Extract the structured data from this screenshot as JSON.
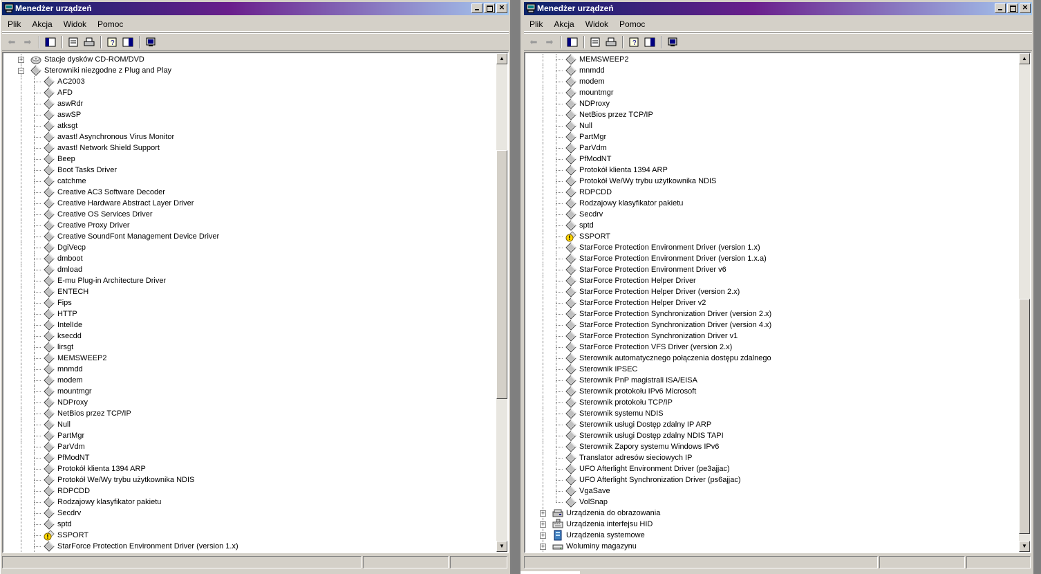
{
  "left_window": {
    "title": "Menedżer urządzeń",
    "menu": [
      "Plik",
      "Akcja",
      "Widok",
      "Pomoc"
    ],
    "tree": [
      {
        "label": "Stacje dysków CD-ROM/DVD",
        "level": 0,
        "expander": "+",
        "icon": "cdrom-icon"
      },
      {
        "label": "Sterowniki niezgodne z Plug and Play",
        "level": 0,
        "expander": "-",
        "icon": "device-icon"
      },
      {
        "label": "AC2003",
        "level": 1,
        "icon": "device-icon"
      },
      {
        "label": "AFD",
        "level": 1,
        "icon": "device-icon"
      },
      {
        "label": "aswRdr",
        "level": 1,
        "icon": "device-icon"
      },
      {
        "label": "aswSP",
        "level": 1,
        "icon": "device-icon"
      },
      {
        "label": "atksgt",
        "level": 1,
        "icon": "device-icon"
      },
      {
        "label": "avast! Asynchronous Virus Monitor",
        "level": 1,
        "icon": "device-icon"
      },
      {
        "label": "avast! Network Shield Support",
        "level": 1,
        "icon": "device-icon"
      },
      {
        "label": "Beep",
        "level": 1,
        "icon": "device-icon"
      },
      {
        "label": "Boot Tasks Driver",
        "level": 1,
        "icon": "device-icon"
      },
      {
        "label": "catchme",
        "level": 1,
        "icon": "device-icon"
      },
      {
        "label": "Creative AC3 Software Decoder",
        "level": 1,
        "icon": "device-icon"
      },
      {
        "label": "Creative Hardware Abstract Layer Driver",
        "level": 1,
        "icon": "device-icon"
      },
      {
        "label": "Creative OS Services Driver",
        "level": 1,
        "icon": "device-icon"
      },
      {
        "label": "Creative Proxy Driver",
        "level": 1,
        "icon": "device-icon"
      },
      {
        "label": "Creative SoundFont Management Device Driver",
        "level": 1,
        "icon": "device-icon"
      },
      {
        "label": "DgiVecp",
        "level": 1,
        "icon": "device-icon"
      },
      {
        "label": "dmboot",
        "level": 1,
        "icon": "device-icon"
      },
      {
        "label": "dmload",
        "level": 1,
        "icon": "device-icon"
      },
      {
        "label": "E-mu Plug-in Architecture Driver",
        "level": 1,
        "icon": "device-icon"
      },
      {
        "label": "ENTECH",
        "level": 1,
        "icon": "device-icon"
      },
      {
        "label": "Fips",
        "level": 1,
        "icon": "device-icon"
      },
      {
        "label": "HTTP",
        "level": 1,
        "icon": "device-icon"
      },
      {
        "label": "IntelIde",
        "level": 1,
        "icon": "device-icon"
      },
      {
        "label": "ksecdd",
        "level": 1,
        "icon": "device-icon"
      },
      {
        "label": "lirsgt",
        "level": 1,
        "icon": "device-icon"
      },
      {
        "label": "MEMSWEEP2",
        "level": 1,
        "icon": "device-icon"
      },
      {
        "label": "mnmdd",
        "level": 1,
        "icon": "device-icon"
      },
      {
        "label": "modem",
        "level": 1,
        "icon": "device-icon"
      },
      {
        "label": "mountmgr",
        "level": 1,
        "icon": "device-icon"
      },
      {
        "label": "NDProxy",
        "level": 1,
        "icon": "device-icon"
      },
      {
        "label": "NetBios przez TCP/IP",
        "level": 1,
        "icon": "device-icon"
      },
      {
        "label": "Null",
        "level": 1,
        "icon": "device-icon"
      },
      {
        "label": "PartMgr",
        "level": 1,
        "icon": "device-icon"
      },
      {
        "label": "ParVdm",
        "level": 1,
        "icon": "device-icon"
      },
      {
        "label": "PfModNT",
        "level": 1,
        "icon": "device-icon"
      },
      {
        "label": "Protokół klienta 1394 ARP",
        "level": 1,
        "icon": "device-icon"
      },
      {
        "label": "Protokół We/Wy trybu użytkownika NDIS",
        "level": 1,
        "icon": "device-icon"
      },
      {
        "label": "RDPCDD",
        "level": 1,
        "icon": "device-icon"
      },
      {
        "label": "Rodzajowy klasyfikator pakietu",
        "level": 1,
        "icon": "device-icon"
      },
      {
        "label": "Secdrv",
        "level": 1,
        "icon": "device-icon"
      },
      {
        "label": "sptd",
        "level": 1,
        "icon": "device-icon"
      },
      {
        "label": "SSPORT",
        "level": 1,
        "icon": "warning-icon"
      },
      {
        "label": "StarForce Protection Environment Driver (version 1.x)",
        "level": 1,
        "icon": "device-icon"
      }
    ]
  },
  "right_window": {
    "title": "Menedżer urządzeń",
    "menu": [
      "Plik",
      "Akcja",
      "Widok",
      "Pomoc"
    ],
    "tree": [
      {
        "label": "MEMSWEEP2",
        "level": 1,
        "icon": "device-icon"
      },
      {
        "label": "mnmdd",
        "level": 1,
        "icon": "device-icon"
      },
      {
        "label": "modem",
        "level": 1,
        "icon": "device-icon"
      },
      {
        "label": "mountmgr",
        "level": 1,
        "icon": "device-icon"
      },
      {
        "label": "NDProxy",
        "level": 1,
        "icon": "device-icon"
      },
      {
        "label": "NetBios przez TCP/IP",
        "level": 1,
        "icon": "device-icon"
      },
      {
        "label": "Null",
        "level": 1,
        "icon": "device-icon"
      },
      {
        "label": "PartMgr",
        "level": 1,
        "icon": "device-icon"
      },
      {
        "label": "ParVdm",
        "level": 1,
        "icon": "device-icon"
      },
      {
        "label": "PfModNT",
        "level": 1,
        "icon": "device-icon"
      },
      {
        "label": "Protokół klienta 1394 ARP",
        "level": 1,
        "icon": "device-icon"
      },
      {
        "label": "Protokół We/Wy trybu użytkownika NDIS",
        "level": 1,
        "icon": "device-icon"
      },
      {
        "label": "RDPCDD",
        "level": 1,
        "icon": "device-icon"
      },
      {
        "label": "Rodzajowy klasyfikator pakietu",
        "level": 1,
        "icon": "device-icon"
      },
      {
        "label": "Secdrv",
        "level": 1,
        "icon": "device-icon"
      },
      {
        "label": "sptd",
        "level": 1,
        "icon": "device-icon"
      },
      {
        "label": "SSPORT",
        "level": 1,
        "icon": "warning-icon"
      },
      {
        "label": "StarForce Protection Environment Driver (version 1.x)",
        "level": 1,
        "icon": "device-icon"
      },
      {
        "label": "StarForce Protection Environment Driver (version 1.x.a)",
        "level": 1,
        "icon": "device-icon"
      },
      {
        "label": "StarForce Protection Environment Driver v6",
        "level": 1,
        "icon": "device-icon"
      },
      {
        "label": "StarForce Protection Helper Driver",
        "level": 1,
        "icon": "device-icon"
      },
      {
        "label": "StarForce Protection Helper Driver (version 2.x)",
        "level": 1,
        "icon": "device-icon"
      },
      {
        "label": "StarForce Protection Helper Driver v2",
        "level": 1,
        "icon": "device-icon"
      },
      {
        "label": "StarForce Protection Synchronization Driver (version 2.x)",
        "level": 1,
        "icon": "device-icon"
      },
      {
        "label": "StarForce Protection Synchronization Driver (version 4.x)",
        "level": 1,
        "icon": "device-icon"
      },
      {
        "label": "StarForce Protection Synchronization Driver v1",
        "level": 1,
        "icon": "device-icon"
      },
      {
        "label": "StarForce Protection VFS Driver (version 2.x)",
        "level": 1,
        "icon": "device-icon"
      },
      {
        "label": "Sterownik automatycznego połączenia dostępu zdalnego",
        "level": 1,
        "icon": "device-icon"
      },
      {
        "label": "Sterownik IPSEC",
        "level": 1,
        "icon": "device-icon"
      },
      {
        "label": "Sterownik PnP magistrali ISA/EISA",
        "level": 1,
        "icon": "device-icon"
      },
      {
        "label": "Sterownik protokołu IPv6 Microsoft",
        "level": 1,
        "icon": "device-icon"
      },
      {
        "label": "Sterownik protokołu TCP/IP",
        "level": 1,
        "icon": "device-icon"
      },
      {
        "label": "Sterownik systemu NDIS",
        "level": 1,
        "icon": "device-icon"
      },
      {
        "label": "Sterownik usługi Dostęp zdalny IP ARP",
        "level": 1,
        "icon": "device-icon"
      },
      {
        "label": "Sterownik usługi Dostęp zdalny NDIS TAPI",
        "level": 1,
        "icon": "device-icon"
      },
      {
        "label": "Sterownik Zapory systemu Windows IPv6",
        "level": 1,
        "icon": "device-icon"
      },
      {
        "label": "Translator adresów sieciowych IP",
        "level": 1,
        "icon": "device-icon"
      },
      {
        "label": "UFO Afterlight Environment Driver (pe3ajjac)",
        "level": 1,
        "icon": "device-icon"
      },
      {
        "label": "UFO Afterlight Synchronization Driver (ps6ajjac)",
        "level": 1,
        "icon": "device-icon"
      },
      {
        "label": "VgaSave",
        "level": 1,
        "icon": "device-icon"
      },
      {
        "label": "VolSnap",
        "level": 1,
        "icon": "device-icon",
        "last": true
      },
      {
        "label": "Urządzenia do obrazowania",
        "level": 0,
        "expander": "+",
        "icon": "scanner-icon"
      },
      {
        "label": "Urządzenia interfejsu HID",
        "level": 0,
        "expander": "+",
        "icon": "hid-icon"
      },
      {
        "label": "Urządzenia systemowe",
        "level": 0,
        "expander": "+",
        "icon": "system-icon"
      },
      {
        "label": "Woluminy magazynu",
        "level": 0,
        "expander": "+",
        "icon": "storage-icon"
      }
    ]
  },
  "colors": {
    "title_start": "#0a246a",
    "title_mid": "#6a1f8c",
    "title_end": "#a6caf0",
    "face": "#d4d0c8",
    "warning": "#ffd700"
  }
}
